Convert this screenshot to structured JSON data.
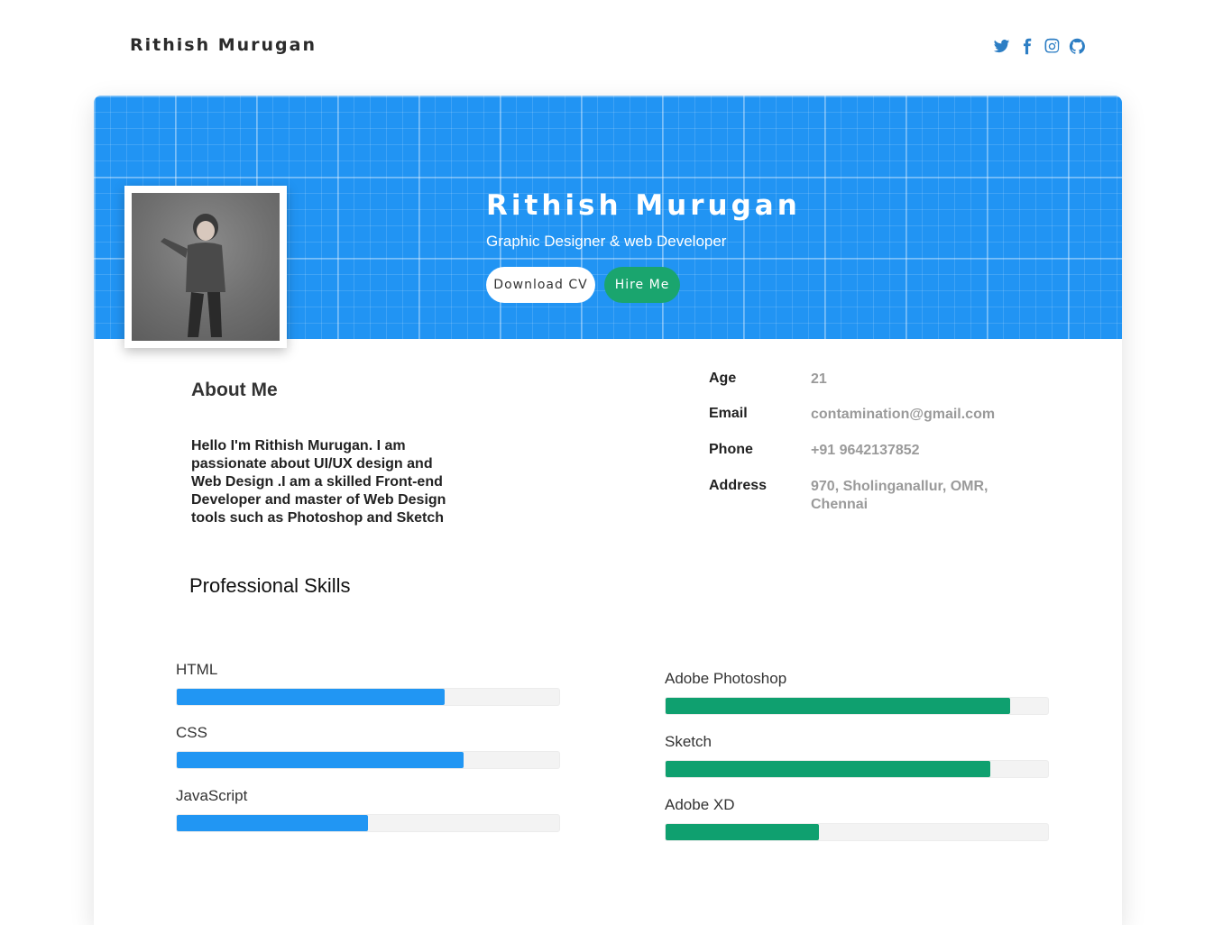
{
  "nav": {
    "brand": "Rithish Murugan",
    "socials": [
      "twitter-icon",
      "facebook-icon",
      "instagram-icon",
      "github-icon"
    ]
  },
  "hero": {
    "name": "Rithish Murugan",
    "role": "Graphic Designer & web Developer",
    "download_label": "Download CV",
    "hire_label": "Hire Me",
    "accent_color": "#2194f3",
    "hire_color": "#1aa56e"
  },
  "about": {
    "title": "About Me",
    "text": "Hello I'm Rithish Murugan. I am passionate about UI/UX design and Web Design .I am a skilled Front-end Developer and master of Web Design tools such as Photoshop and Sketch"
  },
  "info": [
    {
      "label": "Age",
      "value": "21"
    },
    {
      "label": "Email",
      "value": "contamination@gmail.com"
    },
    {
      "label": "Phone",
      "value": "+91 9642137852"
    },
    {
      "label": "Address",
      "value": "970, Sholinganallur, OMR, Chennai"
    }
  ],
  "skills": {
    "title": "Professional Skills",
    "left": [
      {
        "name": "HTML",
        "level": 0.7
      },
      {
        "name": "CSS",
        "level": 0.75
      },
      {
        "name": "JavaScript",
        "level": 0.5
      }
    ],
    "right": [
      {
        "name": "Adobe Photoshop",
        "level": 0.9
      },
      {
        "name": "Sketch",
        "level": 0.85
      },
      {
        "name": "Adobe XD",
        "level": 0.4
      }
    ],
    "left_color": "#2196f3",
    "right_color": "#0fa06f"
  }
}
